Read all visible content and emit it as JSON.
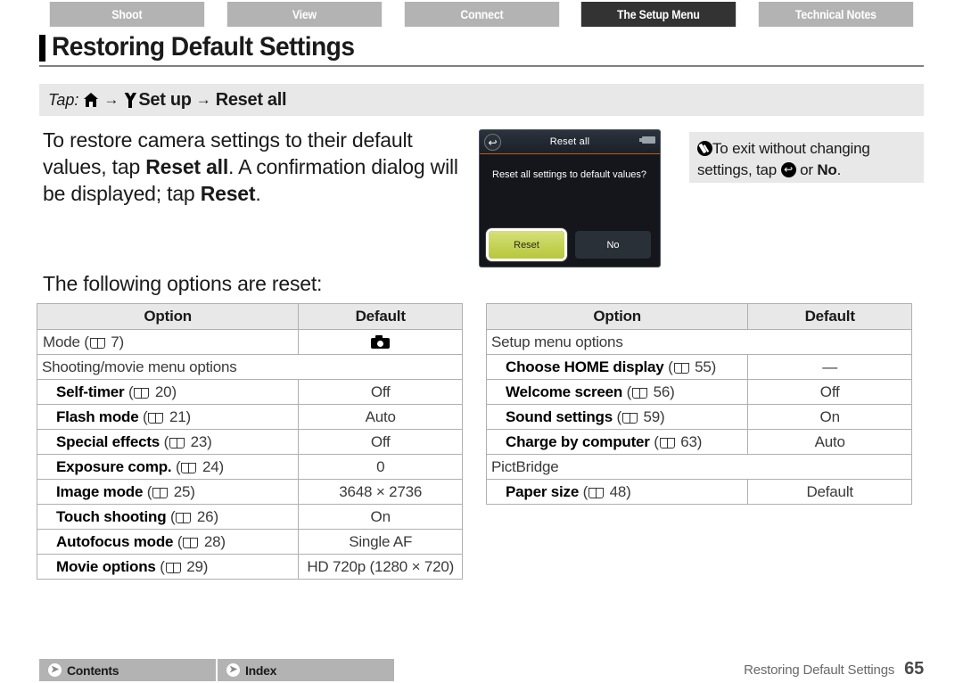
{
  "tabs": [
    {
      "label": "Shoot",
      "active": false
    },
    {
      "label": "View",
      "active": false
    },
    {
      "label": "Connect",
      "active": false
    },
    {
      "label": "The Setup Menu",
      "active": true
    },
    {
      "label": "Technical Notes",
      "active": false
    }
  ],
  "page_title": "Restoring Default Settings",
  "tap_path": {
    "prefix": "Tap:",
    "home_icon": "home-icon",
    "arrow": "→",
    "wrench_icon": "wrench-icon",
    "setup_label": "Set up",
    "target_label": "Reset all"
  },
  "body": {
    "para_1_a": "To restore camera settings to their default values, tap ",
    "para_1_bold_1": "Reset all",
    "para_1_b": ". A confirmation dialog will be displayed; tap ",
    "para_1_bold_2": "Reset",
    "para_1_c": ".",
    "following_heading": "The following options are reset:"
  },
  "camera_screen": {
    "title": "Reset all",
    "back_icon": "back-arrow-icon",
    "battery_icon": "battery-icon",
    "message": "Reset all settings to default values?",
    "button_confirm": "Reset",
    "button_cancel": "No"
  },
  "note": {
    "icon": "pencil-note-icon",
    "text_a": "To exit without changing settings, tap ",
    "inline_icon": "return-icon",
    "text_b": " or ",
    "bold": "No",
    "text_c": "."
  },
  "table_left": {
    "headers": {
      "option": "Option",
      "default": "Default"
    },
    "rows": [
      {
        "type": "plain",
        "name": "Mode",
        "bold": false,
        "page": "7",
        "default": "",
        "default_icon": "camera-icon"
      },
      {
        "type": "section",
        "name": "Shooting/movie menu options"
      },
      {
        "type": "sub",
        "name": "Self-timer",
        "bold": true,
        "page": "20",
        "default": "Off"
      },
      {
        "type": "sub",
        "name": "Flash mode",
        "bold": true,
        "page": "21",
        "default": "Auto"
      },
      {
        "type": "sub",
        "name": "Special effects",
        "bold": true,
        "page": "23",
        "default": "Off"
      },
      {
        "type": "sub",
        "name": "Exposure comp.",
        "bold": true,
        "page": "24",
        "default": "0"
      },
      {
        "type": "sub",
        "name": "Image mode",
        "bold": true,
        "page": "25",
        "default": "3648 × 2736"
      },
      {
        "type": "sub",
        "name": "Touch shooting",
        "bold": true,
        "page": "26",
        "default": "On"
      },
      {
        "type": "sub",
        "name": "Autofocus mode",
        "bold": true,
        "page": "28",
        "default": "Single AF"
      },
      {
        "type": "sub",
        "name": "Movie options",
        "bold": true,
        "page": "29",
        "default": "HD 720p (1280 × 720)"
      }
    ]
  },
  "table_right": {
    "headers": {
      "option": "Option",
      "default": "Default"
    },
    "rows": [
      {
        "type": "section",
        "name": "Setup menu options"
      },
      {
        "type": "sub",
        "name": "Choose HOME display",
        "bold": true,
        "page": "55",
        "default": "—"
      },
      {
        "type": "sub",
        "name": "Welcome screen",
        "bold": true,
        "page": "56",
        "default": "Off"
      },
      {
        "type": "sub",
        "name": "Sound settings",
        "bold": true,
        "page": "59",
        "default": "On"
      },
      {
        "type": "sub",
        "name": "Charge by computer",
        "bold": true,
        "page": "63",
        "default": "Auto"
      },
      {
        "type": "section",
        "name": "PictBridge"
      },
      {
        "type": "sub",
        "name": "Paper size",
        "bold": true,
        "page": "48",
        "default": "Default"
      }
    ]
  },
  "footer": {
    "contents_label": "Contents",
    "index_label": "Index",
    "contents_icon": "arrow-right-circle-icon",
    "index_icon": "arrow-right-circle-icon",
    "running_title": "Restoring Default Settings",
    "page_number": "65"
  }
}
